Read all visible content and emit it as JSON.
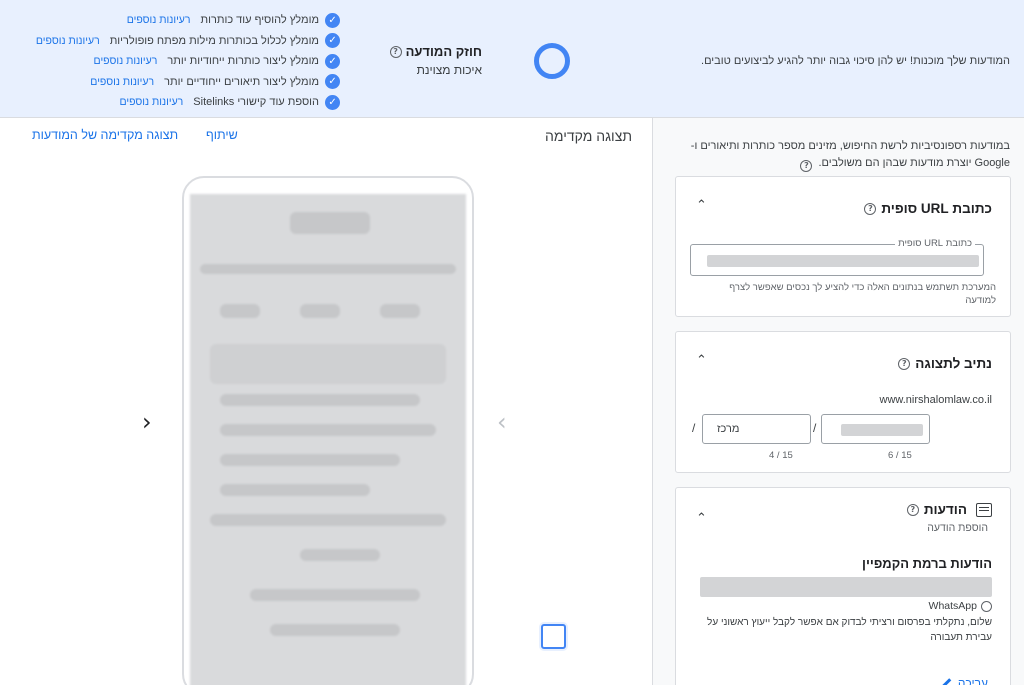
{
  "banner": {
    "message": "המודעות שלך מוכנות! יש להן סיכוי גבוה יותר להגיע לביצועים טובים.",
    "strength_title": "חוזק המודעה",
    "strength_value": "איכות מצוינת",
    "checklist": [
      {
        "text": "מומלץ להוסיף עוד כותרות",
        "link": "רעיונות נוספים"
      },
      {
        "text": "מומלץ לכלול בכותרות מילות מפתח פופולריות",
        "link": "רעיונות נוספים"
      },
      {
        "text": "מומלץ ליצור כותרות ייחודיות יותר",
        "link": "רעיונות נוספים"
      },
      {
        "text": "מומלץ ליצור תיאורים ייחודיים יותר",
        "link": "רעיונות נוספים"
      },
      {
        "text": "הוספת עוד קישורי Sitelinks",
        "link": "רעיונות נוספים"
      }
    ]
  },
  "preview": {
    "title": "תצוגה מקדימה",
    "share": "שיתוף",
    "ad_preview": "תצוגה מקדימה של המודעות"
  },
  "panel": {
    "intro": "במודעות רספונסיביות לרשת החיפוש, מזינים מספר כותרות ותיאורים ו-Google יוצרת מודעות שבהן הם משולבים.",
    "final_url": {
      "title": "כתובת URL סופית",
      "field_label": "כתובת URL סופית",
      "helper": "המערכת תשתמש בנתונים האלה כדי להציע לך נכסים שאפשר לצרף למודעה"
    },
    "display_path": {
      "title": "נתיב לתצוגה",
      "domain": "www.nirshalomlaw.co.il",
      "path2_value": "מרכז",
      "path1_count": "6 / 15",
      "path2_count": "4 / 15"
    },
    "messages": {
      "title": "הודעות",
      "subtitle": "הוספת הודעה",
      "campaign_title": "הודעות ברמת הקמפיין",
      "whatsapp_label": "WhatsApp",
      "whatsapp_text": "שלום, נתקלתי בפרסום ורציתי לבדוק אם אפשר לקבל ייעוץ ראשוני על עבירת תעבורה",
      "edit": "עריכה"
    }
  },
  "colors": {
    "accent": "#4285f4",
    "link": "#1a73e8",
    "banner_bg": "#e8f0fe",
    "panel_bg": "#f8f9fa"
  }
}
